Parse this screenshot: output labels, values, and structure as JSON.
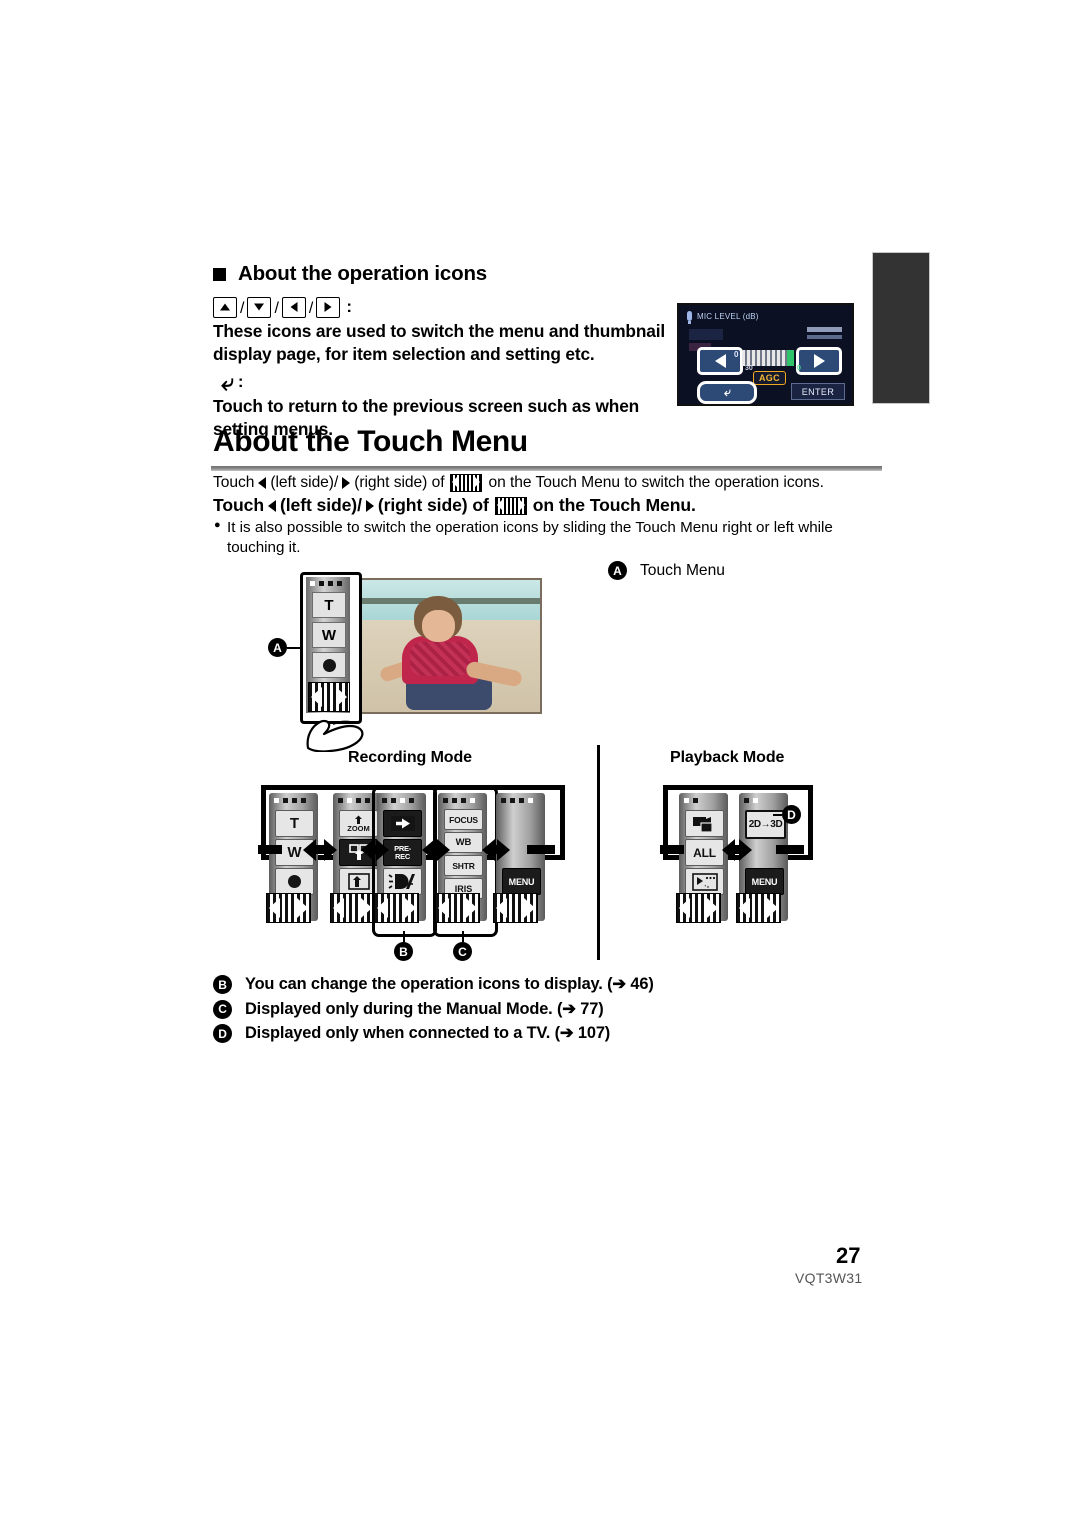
{
  "document": {
    "page_number": "27",
    "product_code": "VQT3W31"
  },
  "operation_icons_section": {
    "heading": "About the operation icons",
    "icon_keys": [
      "up-arrow-icon",
      "down-arrow-icon",
      "left-arrow-icon",
      "right-arrow-icon"
    ],
    "separator": "/",
    "colon": ":",
    "description": "These icons are used to switch the menu and thumbnail display page, for item selection and setting etc.",
    "return_icon": "return-arrow-icon",
    "return_colon": ":",
    "return_description": "Touch to return to the previous screen such as when setting menus."
  },
  "screenshot": {
    "title": "MIC LEVEL (dB)",
    "mic_icon": "microphone-icon",
    "left_button": "left-arrow-icon",
    "right_button": "right-arrow-icon",
    "meter_left_value": "0",
    "meter_right_value": "0",
    "meter_scale_value": "30",
    "agc_label": "AGC",
    "return_button": "return-arrow-icon",
    "enter_button": "ENTER"
  },
  "touch_menu_section": {
    "heading": "About the Touch Menu",
    "intro_parts": {
      "p1": "Touch",
      "p2": "(left side)/",
      "p3": "(right side) of",
      "p4": "on the Touch Menu to switch the operation icons."
    },
    "bold_parts": {
      "p1": "Touch",
      "p2": "(left side)/",
      "p3": "(right side) of",
      "p4": "on the Touch Menu."
    },
    "bullet": "It is also possible to switch the operation icons by sliding the Touch Menu right or left while touching it.",
    "bullet_mark": "●",
    "callout_a": {
      "marker": "A",
      "label": "Touch Menu"
    },
    "illustration": {
      "buttons": [
        "T",
        "W",
        "record-dot-icon"
      ],
      "touch_menu_switch": "touch-menu-switch-icon",
      "hand": "hand-pointer-icon"
    }
  },
  "recording_mode": {
    "label": "Recording Mode",
    "panels": [
      {
        "name": "zoom-record-panel",
        "items": [
          {
            "label": "T",
            "icon": "tele-zoom-icon"
          },
          {
            "label": "W",
            "icon": "wide-zoom-icon"
          },
          {
            "label": "",
            "icon": "record-dot-icon"
          }
        ]
      },
      {
        "name": "touch-functions-panel",
        "items": [
          {
            "label": "ZOOM",
            "icon": "touch-zoom-icon"
          },
          {
            "label": "",
            "icon": "touch-shutter-icon"
          },
          {
            "label": "",
            "icon": "touch-screen-icon"
          }
        ]
      },
      {
        "name": "fade-prerec-panel",
        "items": [
          {
            "label": "",
            "icon": "fade-icon"
          },
          {
            "label": "PRE-REC",
            "icon": "pre-rec-icon"
          },
          {
            "label": "",
            "icon": "backlight-compensation-icon"
          }
        ]
      },
      {
        "name": "manual-settings-panel",
        "items": [
          {
            "label": "FOCUS",
            "icon": "focus-icon"
          },
          {
            "label": "WB",
            "icon": "white-balance-icon"
          },
          {
            "label": "SHTR",
            "icon": "shutter-speed-icon"
          },
          {
            "label": "IRIS",
            "icon": "iris-icon"
          }
        ]
      },
      {
        "name": "menu-panel",
        "items": [
          {
            "label": "MENU",
            "icon": "menu-icon"
          }
        ]
      }
    ],
    "markers": [
      "B",
      "C"
    ]
  },
  "playback_mode": {
    "label": "Playback Mode",
    "panels": [
      {
        "name": "playback-select-panel",
        "items": [
          {
            "label": "",
            "icon": "video-photo-switch-icon"
          },
          {
            "label": "ALL",
            "icon": "all-icon"
          },
          {
            "label": "",
            "icon": "highlight-playback-icon"
          }
        ]
      },
      {
        "name": "playback-menu-panel",
        "items": [
          {
            "label": "2D→3D",
            "icon": "2d-to-3d-icon"
          },
          {
            "label": "MENU",
            "icon": "menu-icon"
          }
        ]
      }
    ],
    "markers": [
      "D"
    ]
  },
  "footnotes": [
    {
      "marker": "B",
      "text": "You can change the operation icons to display. (➔ 46)"
    },
    {
      "marker": "C",
      "text": "Displayed only during the Manual Mode. (➔ 77)"
    },
    {
      "marker": "D",
      "text": "Displayed only when connected to a TV. (➔ 107)"
    }
  ]
}
